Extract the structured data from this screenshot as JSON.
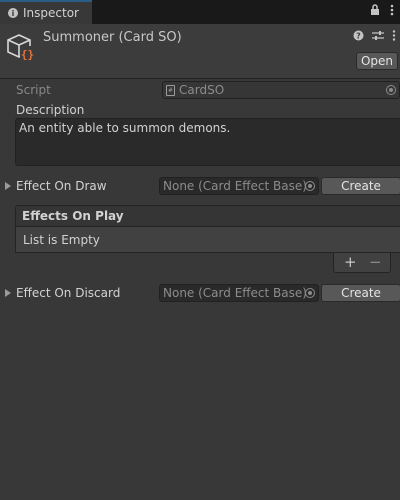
{
  "tab": {
    "label": "Inspector"
  },
  "header": {
    "title": "Summoner (Card SO)",
    "open_label": "Open"
  },
  "script_row": {
    "label": "Script",
    "value": "CardSO"
  },
  "description": {
    "label": "Description",
    "value": "An entity able to summon demons."
  },
  "effect_on_draw": {
    "label": "Effect On Draw",
    "value": "None (Card Effect Base)",
    "button": "Create"
  },
  "effects_on_play": {
    "label": "Effects On Play",
    "empty_text": "List is Empty",
    "add": "+",
    "remove": "−"
  },
  "effect_on_discard": {
    "label": "Effect On Discard",
    "value": "None (Card Effect Base)",
    "button": "Create"
  },
  "icons": [
    "info-icon",
    "lock-icon",
    "kebab-menu-icon",
    "help-icon",
    "settings-sliders-icon",
    "cube-script-icon",
    "object-picker-icon"
  ],
  "colors": {
    "background": "#383838",
    "tab_accent": "#2c5d87",
    "object_icon_accent": "#e8743b"
  }
}
